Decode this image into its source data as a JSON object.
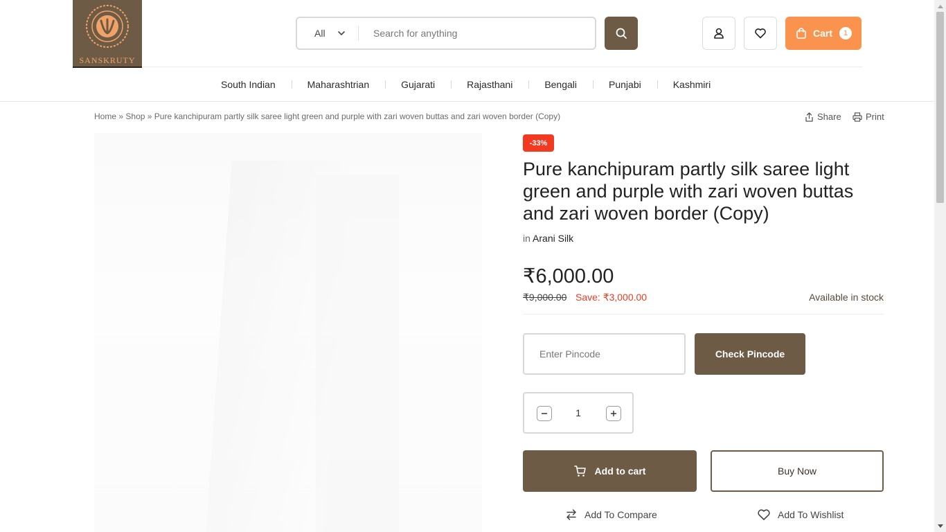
{
  "header": {
    "logo_text": "SANSKRUTY",
    "search": {
      "category": "All",
      "placeholder": "Search for anything"
    },
    "cart": {
      "label": "Cart",
      "count": "1"
    }
  },
  "nav": {
    "items": [
      "South Indian",
      "Maharashtrian",
      "Gujarati",
      "Rajasthani",
      "Bengali",
      "Punjabi",
      "Kashmiri"
    ]
  },
  "breadcrumb": {
    "home": "Home",
    "sep": "»",
    "shop": "Shop",
    "current": "Pure kanchipuram partly silk saree light green and purple with zari woven buttas and zari woven border (Copy)"
  },
  "actions": {
    "share": "Share",
    "print": "Print"
  },
  "product": {
    "discount": "-33%",
    "title": "Pure kanchipuram partly silk saree light green and purple with zari woven buttas and zari woven border (Copy)",
    "category_prefix": "in",
    "category": "Arani Silk",
    "price": "₹6,000.00",
    "old_price": "₹9,000.00",
    "save": "Save: ₹3,000.00",
    "stock": "Available in stock",
    "pincode_placeholder": "Enter Pincode",
    "check_pincode": "Check Pincode",
    "quantity": "1",
    "add_to_cart": "Add to cart",
    "buy_now": "Buy Now",
    "add_to_compare": "Add To Compare",
    "add_to_wishlist": "Add To Wishlist"
  },
  "colors": {
    "brand": "#6e5b46",
    "accent": "#f9934d",
    "sale": "#f23a21"
  },
  "icons": [
    "search-icon",
    "user-icon",
    "heart-icon",
    "bag-icon",
    "share-icon",
    "printer-icon",
    "cart-icon",
    "compare-icon",
    "chevron-down-icon",
    "minus-icon",
    "plus-icon"
  ]
}
